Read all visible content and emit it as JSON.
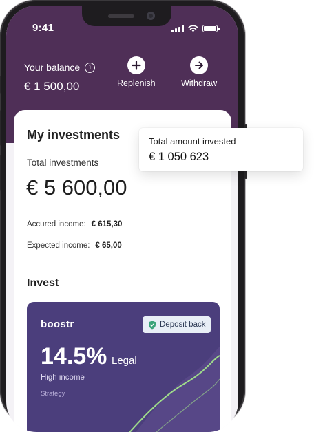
{
  "status_bar": {
    "time": "9:41"
  },
  "header": {
    "balance_label": "Your balance",
    "balance_value": "€ 1 500,00",
    "actions": [
      {
        "label": "Replenish",
        "icon": "plus-icon"
      },
      {
        "label": "Withdraw",
        "icon": "arrow-right-icon"
      }
    ]
  },
  "investments": {
    "title": "My investments",
    "total_label": "Total investments",
    "total_value": "€ 5 600,00",
    "accrued_label": "Accured income:",
    "accrued_value": "€ 615,30",
    "expected_label": "Expected income:",
    "expected_value": "€ 65,00"
  },
  "invest": {
    "title": "Invest",
    "brand": "boostr",
    "badge_label": "Deposit back",
    "rate": "14.5%",
    "rate_type": "Legal",
    "description": "High income",
    "strategy_label": "Strategy"
  },
  "tooltip": {
    "label": "Total amount invested",
    "value": "€ 1 050 623"
  },
  "colors": {
    "header_bg": "#4f2f57",
    "invest_card_bg": "#4b3e7c",
    "chart_line": "#9fdc8a",
    "badge_icon": "#3aa37a"
  }
}
